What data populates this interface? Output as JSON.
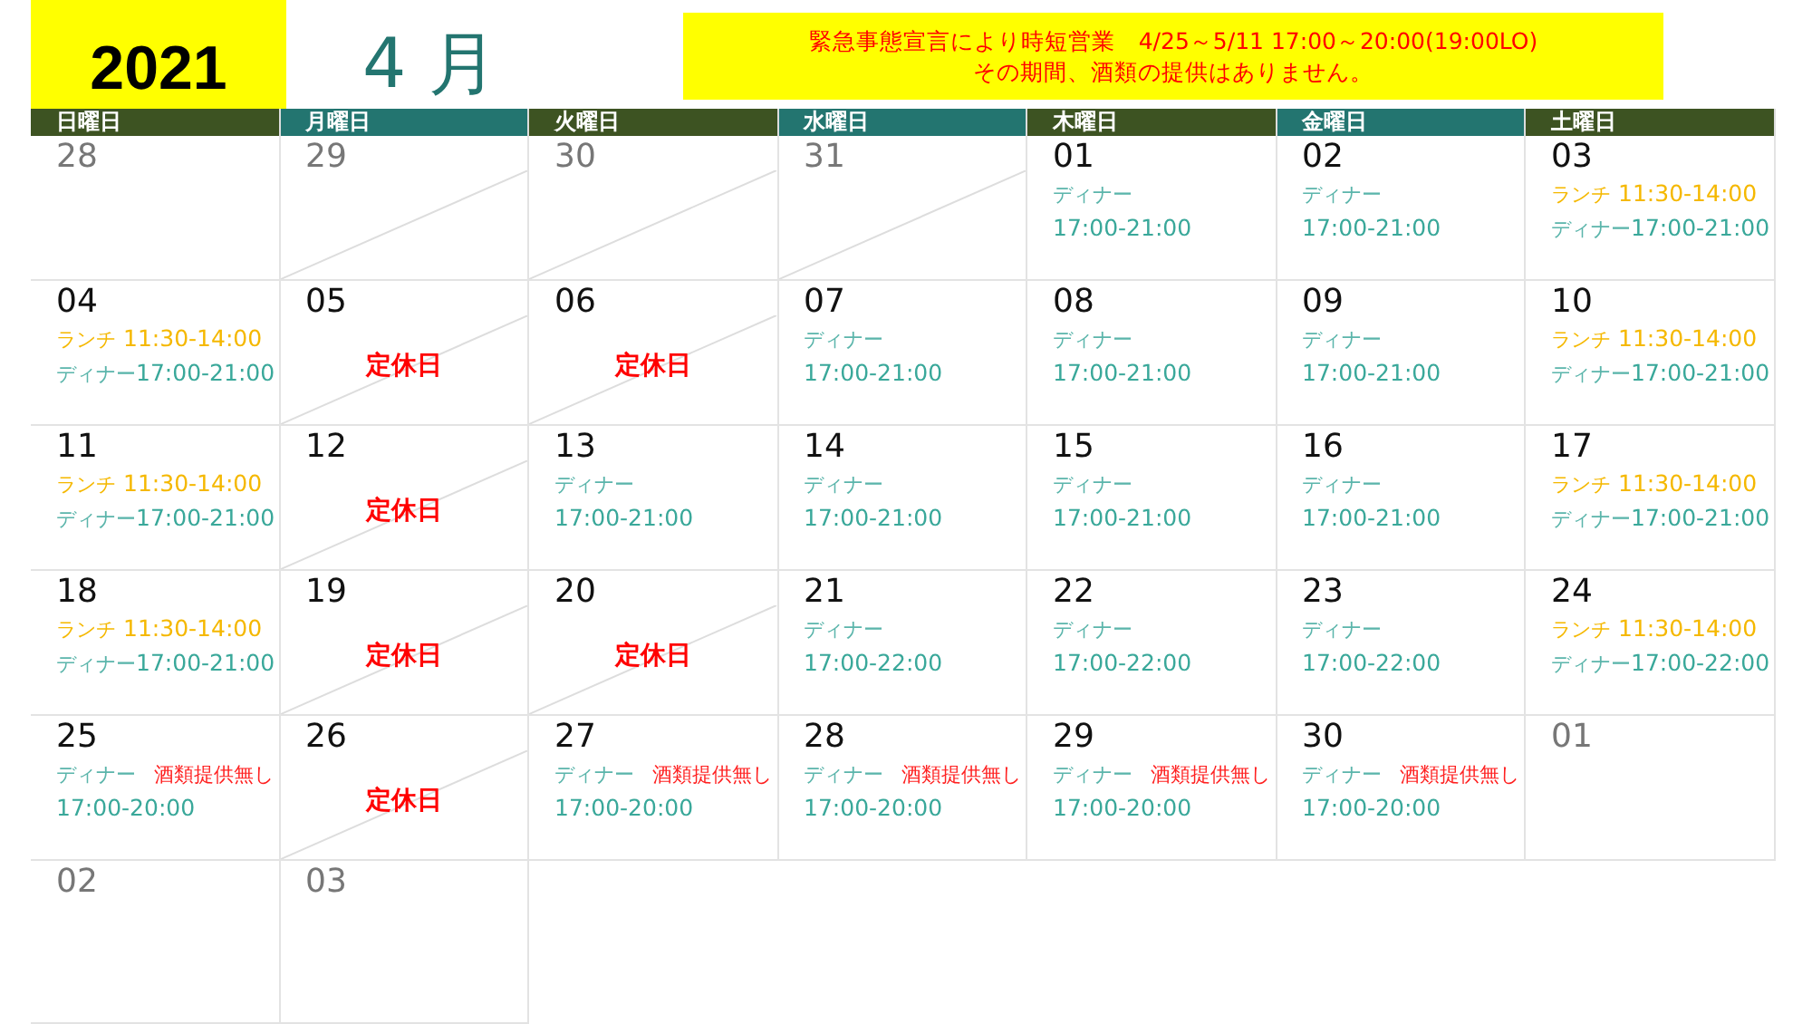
{
  "header": {
    "year": "2021",
    "month": "4 月",
    "notice": [
      "緊急事態宣言により時短営業　4/25～5/11 17:00～20:00(19:00LO)",
      "その期間、酒類の提供はありません。"
    ]
  },
  "weekdays": [
    "日曜日",
    "月曜日",
    "火曜日",
    "水曜日",
    "木曜日",
    "金曜日",
    "土曜日"
  ],
  "weeks": [
    [
      {
        "date": "28",
        "in_month": false,
        "crossed": false
      },
      {
        "date": "29",
        "in_month": false,
        "crossed": true
      },
      {
        "date": "30",
        "in_month": false,
        "crossed": true
      },
      {
        "date": "31",
        "in_month": false,
        "crossed": true
      },
      {
        "date": "01",
        "in_month": true,
        "crossed": false,
        "lines": [
          [
            {
              "kind": "label",
              "text": "ディナー"
            }
          ],
          [
            {
              "kind": "time",
              "text": "17:00-21:00"
            }
          ]
        ]
      },
      {
        "date": "02",
        "in_month": true,
        "crossed": false,
        "lines": [
          [
            {
              "kind": "label",
              "text": "ディナー"
            }
          ],
          [
            {
              "kind": "time",
              "text": "17:00-21:00"
            }
          ]
        ]
      },
      {
        "date": "03",
        "in_month": true,
        "crossed": false,
        "lines": [
          [
            {
              "kind": "lunch-label",
              "text": "ランチ"
            },
            {
              "kind": "lunch-time",
              "text": "11:30-14:00"
            }
          ],
          [
            {
              "kind": "label",
              "text": "ディナー"
            },
            {
              "kind": "time",
              "text": "17:00-21:00"
            }
          ]
        ]
      }
    ],
    [
      {
        "date": "04",
        "in_month": true,
        "crossed": false,
        "lines": [
          [
            {
              "kind": "lunch-label",
              "text": "ランチ"
            },
            {
              "kind": "lunch-time",
              "text": "11:30-14:00"
            }
          ],
          [
            {
              "kind": "label",
              "text": "ディナー"
            },
            {
              "kind": "time",
              "text": "17:00-21:00"
            }
          ]
        ]
      },
      {
        "date": "05",
        "in_month": true,
        "crossed": true,
        "closed": "定休日"
      },
      {
        "date": "06",
        "in_month": true,
        "crossed": true,
        "closed": "定休日"
      },
      {
        "date": "07",
        "in_month": true,
        "crossed": false,
        "lines": [
          [
            {
              "kind": "label",
              "text": "ディナー"
            }
          ],
          [
            {
              "kind": "time",
              "text": "17:00-21:00"
            }
          ]
        ]
      },
      {
        "date": "08",
        "in_month": true,
        "crossed": false,
        "lines": [
          [
            {
              "kind": "label",
              "text": "ディナー"
            }
          ],
          [
            {
              "kind": "time",
              "text": "17:00-21:00"
            }
          ]
        ]
      },
      {
        "date": "09",
        "in_month": true,
        "crossed": false,
        "lines": [
          [
            {
              "kind": "label",
              "text": "ディナー"
            }
          ],
          [
            {
              "kind": "time",
              "text": "17:00-21:00"
            }
          ]
        ]
      },
      {
        "date": "10",
        "in_month": true,
        "crossed": false,
        "lines": [
          [
            {
              "kind": "lunch-label",
              "text": "ランチ"
            },
            {
              "kind": "lunch-time",
              "text": "11:30-14:00"
            }
          ],
          [
            {
              "kind": "label",
              "text": "ディナー"
            },
            {
              "kind": "time",
              "text": "17:00-21:00"
            }
          ]
        ]
      }
    ],
    [
      {
        "date": "11",
        "in_month": true,
        "crossed": false,
        "lines": [
          [
            {
              "kind": "lunch-label",
              "text": "ランチ"
            },
            {
              "kind": "lunch-time",
              "text": "11:30-14:00"
            }
          ],
          [
            {
              "kind": "label",
              "text": "ディナー"
            },
            {
              "kind": "time",
              "text": "17:00-21:00"
            }
          ]
        ]
      },
      {
        "date": "12",
        "in_month": true,
        "crossed": true,
        "closed": "定休日"
      },
      {
        "date": "13",
        "in_month": true,
        "crossed": false,
        "lines": [
          [
            {
              "kind": "label",
              "text": "ディナー"
            }
          ],
          [
            {
              "kind": "time",
              "text": "17:00-21:00"
            }
          ]
        ]
      },
      {
        "date": "14",
        "in_month": true,
        "crossed": false,
        "lines": [
          [
            {
              "kind": "label",
              "text": "ディナー"
            }
          ],
          [
            {
              "kind": "time",
              "text": "17:00-21:00"
            }
          ]
        ]
      },
      {
        "date": "15",
        "in_month": true,
        "crossed": false,
        "lines": [
          [
            {
              "kind": "label",
              "text": "ディナー"
            }
          ],
          [
            {
              "kind": "time",
              "text": "17:00-21:00"
            }
          ]
        ]
      },
      {
        "date": "16",
        "in_month": true,
        "crossed": false,
        "lines": [
          [
            {
              "kind": "label",
              "text": "ディナー"
            }
          ],
          [
            {
              "kind": "time",
              "text": "17:00-21:00"
            }
          ]
        ]
      },
      {
        "date": "17",
        "in_month": true,
        "crossed": false,
        "lines": [
          [
            {
              "kind": "lunch-label",
              "text": "ランチ"
            },
            {
              "kind": "lunch-time",
              "text": "11:30-14:00"
            }
          ],
          [
            {
              "kind": "label",
              "text": "ディナー"
            },
            {
              "kind": "time",
              "text": "17:00-21:00"
            }
          ]
        ]
      }
    ],
    [
      {
        "date": "18",
        "in_month": true,
        "crossed": false,
        "lines": [
          [
            {
              "kind": "lunch-label",
              "text": "ランチ"
            },
            {
              "kind": "lunch-time",
              "text": "11:30-14:00"
            }
          ],
          [
            {
              "kind": "label",
              "text": "ディナー"
            },
            {
              "kind": "time",
              "text": "17:00-21:00"
            }
          ]
        ]
      },
      {
        "date": "19",
        "in_month": true,
        "crossed": true,
        "closed": "定休日"
      },
      {
        "date": "20",
        "in_month": true,
        "crossed": true,
        "closed": "定休日"
      },
      {
        "date": "21",
        "in_month": true,
        "crossed": false,
        "lines": [
          [
            {
              "kind": "label",
              "text": "ディナー"
            }
          ],
          [
            {
              "kind": "time",
              "text": "17:00-22:00"
            }
          ]
        ]
      },
      {
        "date": "22",
        "in_month": true,
        "crossed": false,
        "lines": [
          [
            {
              "kind": "label",
              "text": "ディナー"
            }
          ],
          [
            {
              "kind": "time",
              "text": "17:00-22:00"
            }
          ]
        ]
      },
      {
        "date": "23",
        "in_month": true,
        "crossed": false,
        "lines": [
          [
            {
              "kind": "label",
              "text": "ディナー"
            }
          ],
          [
            {
              "kind": "time",
              "text": "17:00-22:00"
            }
          ]
        ]
      },
      {
        "date": "24",
        "in_month": true,
        "crossed": false,
        "lines": [
          [
            {
              "kind": "lunch-label",
              "text": "ランチ"
            },
            {
              "kind": "lunch-time",
              "text": "11:30-14:00"
            }
          ],
          [
            {
              "kind": "label",
              "text": "ディナー"
            },
            {
              "kind": "time",
              "text": "17:00-22:00"
            }
          ]
        ]
      }
    ],
    [
      {
        "date": "25",
        "in_month": true,
        "crossed": false,
        "lines": [
          [
            {
              "kind": "label",
              "text": "ディナー"
            },
            {
              "kind": "alert",
              "text": "酒類提供無し"
            }
          ],
          [
            {
              "kind": "time",
              "text": "17:00-20:00"
            }
          ]
        ]
      },
      {
        "date": "26",
        "in_month": true,
        "crossed": true,
        "closed": "定休日"
      },
      {
        "date": "27",
        "in_month": true,
        "crossed": false,
        "lines": [
          [
            {
              "kind": "label",
              "text": "ディナー"
            },
            {
              "kind": "alert",
              "text": "酒類提供無し"
            }
          ],
          [
            {
              "kind": "time",
              "text": "17:00-20:00"
            }
          ]
        ]
      },
      {
        "date": "28",
        "in_month": true,
        "crossed": false,
        "lines": [
          [
            {
              "kind": "label",
              "text": "ディナー"
            },
            {
              "kind": "alert",
              "text": "酒類提供無し"
            }
          ],
          [
            {
              "kind": "time",
              "text": "17:00-20:00"
            }
          ]
        ]
      },
      {
        "date": "29",
        "in_month": true,
        "crossed": false,
        "lines": [
          [
            {
              "kind": "label",
              "text": "ディナー"
            },
            {
              "kind": "alert",
              "text": "酒類提供無し"
            }
          ],
          [
            {
              "kind": "time",
              "text": "17:00-20:00"
            }
          ]
        ]
      },
      {
        "date": "30",
        "in_month": true,
        "crossed": false,
        "lines": [
          [
            {
              "kind": "label",
              "text": "ディナー"
            },
            {
              "kind": "alert",
              "text": "酒類提供無し"
            }
          ],
          [
            {
              "kind": "time",
              "text": "17:00-20:00"
            }
          ]
        ]
      },
      {
        "date": "01",
        "in_month": false,
        "crossed": false
      }
    ],
    [
      {
        "date": "02",
        "in_month": false,
        "crossed": false
      },
      {
        "date": "03",
        "in_month": false,
        "crossed": false
      }
    ]
  ]
}
